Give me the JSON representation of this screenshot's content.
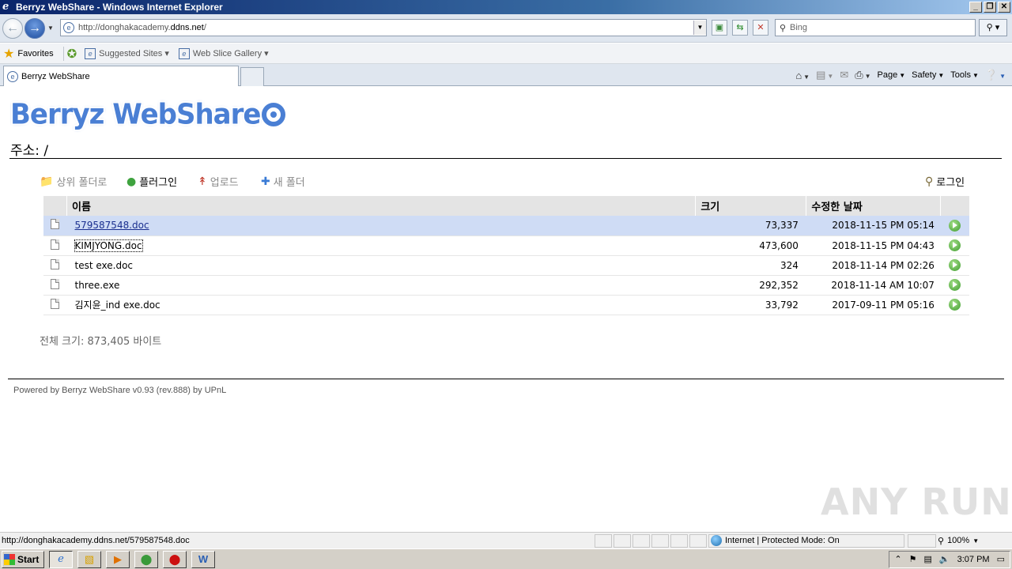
{
  "window": {
    "title": "Berryz WebShare - Windows Internet Explorer",
    "controls": [
      "_",
      "❐",
      "✕"
    ]
  },
  "address": {
    "url_prefix": "http://donghakacademy.",
    "url_host": "ddns.net",
    "url_suffix": "/",
    "search_placeholder": "Bing"
  },
  "favorites": {
    "label": "Favorites",
    "links": [
      "Suggested Sites ▾",
      "Web Slice Gallery ▾"
    ]
  },
  "tab": {
    "label": "Berryz WebShare"
  },
  "commandbar": {
    "page": "Page",
    "safety": "Safety",
    "tools": "Tools"
  },
  "app": {
    "logo_text": "Berryz WebShare",
    "path_label": "주소: /",
    "toolbar": {
      "up_folder": "상위 폴더로",
      "plugin": "플러그인",
      "upload": "업로드",
      "new_folder": "새 폴더",
      "login": "로그인"
    },
    "columns": {
      "name": "이름",
      "size": "크기",
      "modified": "수정한 날짜"
    },
    "files": [
      {
        "name": "579587548.doc",
        "size": "73,337",
        "date": "2018-11-15 PM 05:14"
      },
      {
        "name": "KIMJYONG.doc",
        "size": "473,600",
        "date": "2018-11-15 PM 04:43"
      },
      {
        "name": "test exe.doc",
        "size": "324",
        "date": "2018-11-14 PM 02:26"
      },
      {
        "name": "three.exe",
        "size": "292,352",
        "date": "2018-11-14 AM 10:07"
      },
      {
        "name": "김지윤_ind exe.doc",
        "size": "33,792",
        "date": "2017-09-11 PM 05:16"
      }
    ],
    "total_size": "전체 크기: 873,405 바이트",
    "footer": "Powered by Berryz WebShare v0.93 (rev.888) by UPnL"
  },
  "statusbar": {
    "text": "http://donghakacademy.ddns.net/579587548.doc",
    "zone": "Internet | Protected Mode: On",
    "zoom": "100%"
  },
  "taskbar": {
    "start": "Start",
    "clock": "3:07 PM"
  },
  "watermark": "ANY RUN",
  "colors": {
    "selected_row": "#cfdcf5",
    "link": "#1a2f8f",
    "logo": "#4a7fd4"
  }
}
